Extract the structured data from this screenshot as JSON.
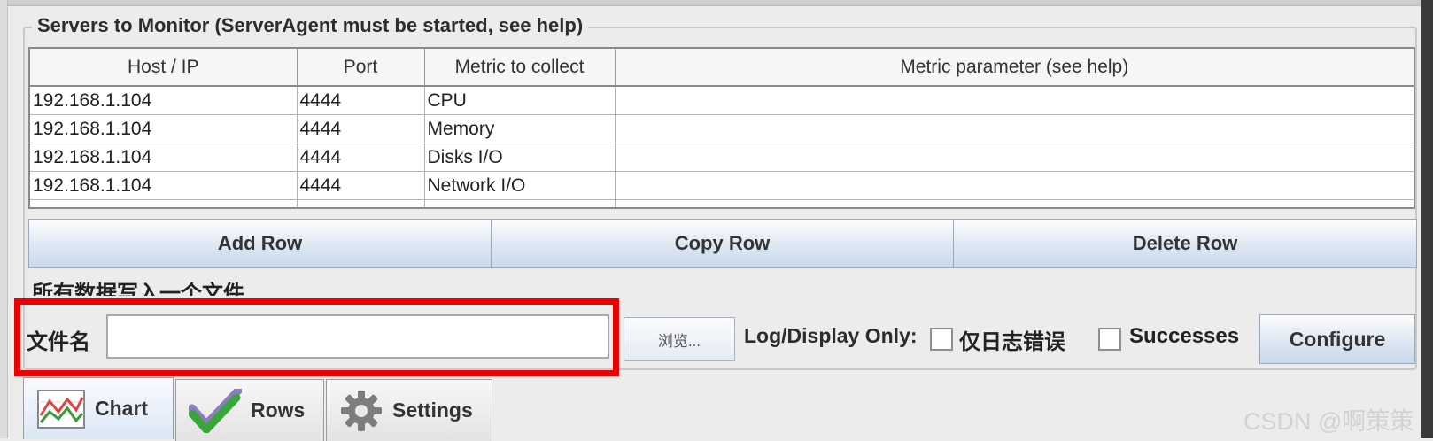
{
  "group_title": "Servers to Monitor (ServerAgent must be started, see help)",
  "table": {
    "headers": [
      "Host / IP",
      "Port",
      "Metric to collect",
      "Metric parameter (see help)"
    ],
    "rows": [
      [
        "192.168.1.104",
        "4444",
        "CPU",
        ""
      ],
      [
        "192.168.1.104",
        "4444",
        "Memory",
        ""
      ],
      [
        "192.168.1.104",
        "4444",
        "Disks I/O",
        ""
      ],
      [
        "192.168.1.104",
        "4444",
        "Network I/O",
        ""
      ]
    ]
  },
  "buttons": {
    "add_row": "Add Row",
    "copy_row": "Copy Row",
    "delete_row": "Delete Row"
  },
  "file_section": {
    "title": "所有数据写入一个文件",
    "label": "文件名",
    "value": "",
    "browse": "浏览...",
    "log_display_only": "Log/Display Only:",
    "errors_only": "仅日志错误",
    "errors_only_checked": false,
    "successes": "Successes",
    "successes_checked": false,
    "configure": "Configure"
  },
  "tabs": [
    {
      "label": "Chart",
      "icon": "chart-icon",
      "active": true
    },
    {
      "label": "Rows",
      "icon": "checkmark-icon",
      "active": false
    },
    {
      "label": "Settings",
      "icon": "gear-icon",
      "active": false
    }
  ],
  "watermark": "CSDN @啊策策",
  "colors": {
    "highlight": "#ee0000",
    "button_gradient_end": "#c9d8ea"
  }
}
